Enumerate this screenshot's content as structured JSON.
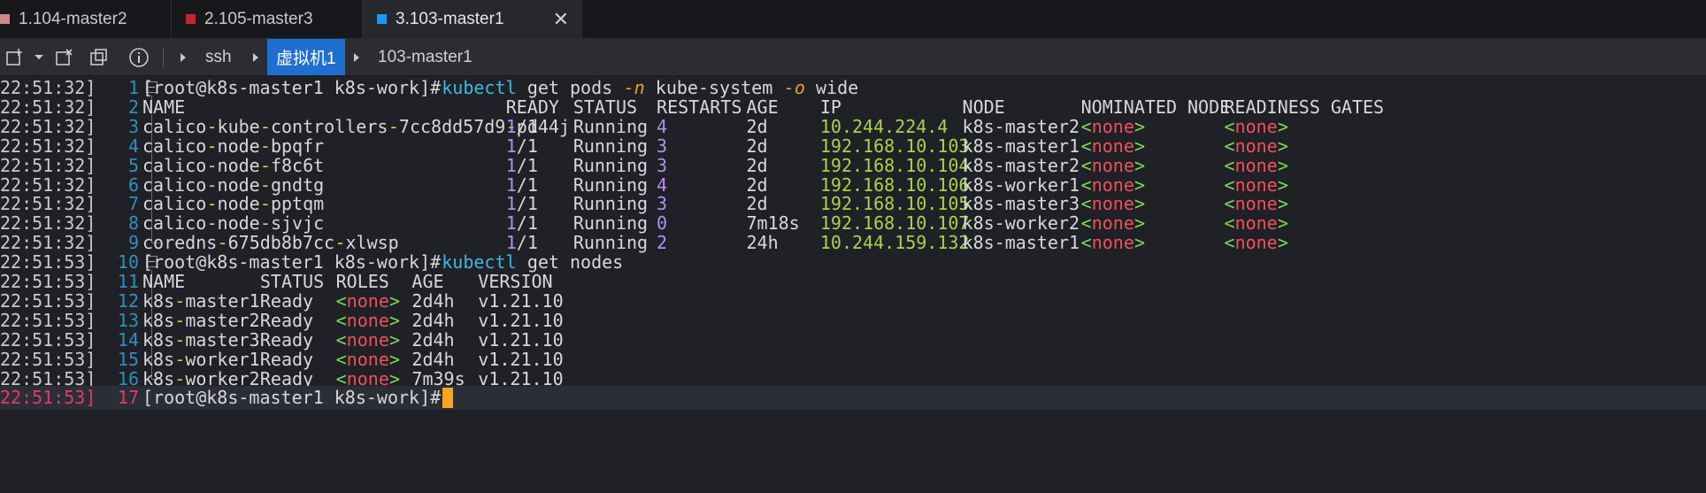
{
  "tabs": [
    {
      "label": "1.104-master2",
      "color": "#c98a8a"
    },
    {
      "label": "2.105-master3",
      "color": "#c1272d"
    },
    {
      "label": "3.103-master1",
      "color": "#2196f3"
    }
  ],
  "tab_close_glyph": "✕",
  "toolbar": {
    "icons": [
      "new-tab-icon",
      "dropdown-icon",
      "close-tab-icon",
      "duplicate-icon",
      "info-icon"
    ],
    "breadcrumbs": [
      "ssh",
      "虚拟机1",
      "103-master1"
    ]
  },
  "terminal": {
    "prompt": "[root@k8s-master1 k8s-work]#",
    "cmd1": {
      "bin": "kubectl",
      "args1": " get pods ",
      "flag1": "-n",
      "args2": " kube-system ",
      "flag2": "-o",
      "args3": " wide"
    },
    "cmd2": {
      "bin": "kubectl",
      "args": " get nodes"
    },
    "pods_header": [
      "NAME",
      "READY",
      "STATUS",
      "RESTARTS",
      "AGE",
      "IP",
      "NODE",
      "NOMINATED NODE",
      "READINESS GATES"
    ],
    "pods": [
      {
        "ts": "22:51:32]",
        "ln": "3",
        "name": [
          "calico",
          "-",
          "kube",
          "-",
          "controllers",
          "-",
          "7cc8dd57d9",
          "-",
          "pd44j"
        ],
        "ready_a": "1",
        "ready_b": "/1",
        "status": "Running",
        "restarts": "4",
        "age": "2d",
        "ip": "10.244.224.4",
        "node": "k8s-master2",
        "nominated": "none",
        "readiness": "none"
      },
      {
        "ts": "22:51:32]",
        "ln": "4",
        "name": [
          "calico",
          "-",
          "node",
          "-",
          "bpqfr"
        ],
        "ready_a": "1",
        "ready_b": "/1",
        "status": "Running",
        "restarts": "3",
        "age": "2d",
        "ip": "192.168.10.103",
        "node": "k8s-master1",
        "nominated": "none",
        "readiness": "none"
      },
      {
        "ts": "22:51:32]",
        "ln": "5",
        "name": [
          "calico",
          "-",
          "node",
          "-",
          "f8c6t"
        ],
        "ready_a": "1",
        "ready_b": "/1",
        "status": "Running",
        "restarts": "3",
        "age": "2d",
        "ip": "192.168.10.104",
        "node": "k8s-master2",
        "nominated": "none",
        "readiness": "none"
      },
      {
        "ts": "22:51:32]",
        "ln": "6",
        "name": [
          "calico",
          "-",
          "node",
          "-",
          "gndtg"
        ],
        "ready_a": "1",
        "ready_b": "/1",
        "status": "Running",
        "restarts": "4",
        "age": "2d",
        "ip": "192.168.10.106",
        "node": "k8s-worker1",
        "nominated": "none",
        "readiness": "none"
      },
      {
        "ts": "22:51:32]",
        "ln": "7",
        "name": [
          "calico",
          "-",
          "node",
          "-",
          "pptqm"
        ],
        "ready_a": "1",
        "ready_b": "/1",
        "status": "Running",
        "restarts": "3",
        "age": "2d",
        "ip": "192.168.10.105",
        "node": "k8s-master3",
        "nominated": "none",
        "readiness": "none"
      },
      {
        "ts": "22:51:32]",
        "ln": "8",
        "name": [
          "calico",
          "-",
          "node",
          "-",
          "sjvjc"
        ],
        "ready_a": "1",
        "ready_b": "/1",
        "status": "Running",
        "restarts": "0",
        "age": "7m18s",
        "ip": "192.168.10.107",
        "node": "k8s-worker2",
        "nominated": "none",
        "readiness": "none"
      },
      {
        "ts": "22:51:32]",
        "ln": "9",
        "name": [
          "coredns",
          "-",
          "675db8b7cc",
          "-",
          "xlwsp"
        ],
        "ready_a": "1",
        "ready_b": "/1",
        "status": "Running",
        "restarts": "2",
        "age": "24h",
        "ip": "10.244.159.132",
        "node": "k8s-master1",
        "nominated": "none",
        "readiness": "none"
      }
    ],
    "nodes_header": [
      "NAME",
      "STATUS",
      "ROLES",
      "AGE",
      "VERSION"
    ],
    "nodes": [
      {
        "ts": "22:51:53]",
        "ln": "12",
        "name": [
          "k8s",
          "-",
          "master1"
        ],
        "status": "Ready",
        "roles": "none",
        "age": "2d4h",
        "version": "v1.21.10"
      },
      {
        "ts": "22:51:53]",
        "ln": "13",
        "name": [
          "k8s",
          "-",
          "master2"
        ],
        "status": "Ready",
        "roles": "none",
        "age": "2d4h",
        "version": "v1.21.10"
      },
      {
        "ts": "22:51:53]",
        "ln": "14",
        "name": [
          "k8s",
          "-",
          "master3"
        ],
        "status": "Ready",
        "roles": "none",
        "age": "2d4h",
        "version": "v1.21.10"
      },
      {
        "ts": "22:51:53]",
        "ln": "15",
        "name": [
          "k8s",
          "-",
          "worker1"
        ],
        "status": "Ready",
        "roles": "none",
        "age": "2d4h",
        "version": "v1.21.10"
      },
      {
        "ts": "22:51:53]",
        "ln": "16",
        "name": [
          "k8s",
          "-",
          "worker2"
        ],
        "status": "Ready",
        "roles": "none",
        "age": "7m39s",
        "version": "v1.21.10"
      }
    ],
    "fixed_rows": [
      {
        "ts": "22:51:32]",
        "ln": "1"
      },
      {
        "ts": "22:51:32]",
        "ln": "2"
      },
      {
        "ts": "22:51:53]",
        "ln": "10"
      },
      {
        "ts": "22:51:53]",
        "ln": "11"
      },
      {
        "ts": "22:51:53]",
        "ln": "17"
      }
    ]
  }
}
